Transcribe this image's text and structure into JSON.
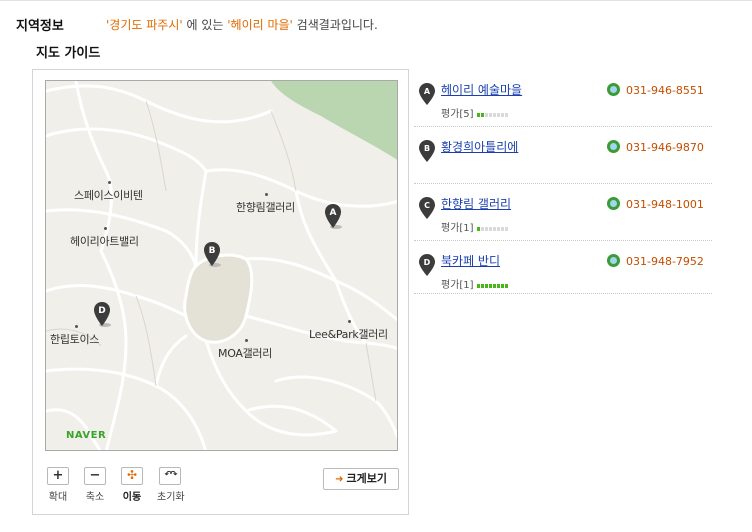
{
  "section": {
    "title": "지역정보"
  },
  "search_result": {
    "region": "'경기도 파주시'",
    "text1": " 에 있는 ",
    "keyword": "'헤이리 마을'",
    "text2": " 검색결과입니다."
  },
  "map": {
    "title": "지도 가이드",
    "places": [
      "스페이스이비텐",
      "한향림갤러리",
      "헤이리아트밸리",
      "한립토이스",
      "Lee&Park갤러리",
      "MOA갤러리"
    ],
    "markers": [
      "A",
      "B",
      "D"
    ],
    "logo": "NAVER",
    "controls": [
      {
        "symbol": "+",
        "label": "확대"
      },
      {
        "symbol": "−",
        "label": "축소"
      },
      {
        "symbol": "✣",
        "label": "이동"
      },
      {
        "symbol": "↶↷",
        "label": "초기화"
      }
    ],
    "bigview": {
      "arrow": "➜",
      "label": "크게보기"
    },
    "colors": {
      "land": "#f1efe9",
      "green": "#b9d6b0",
      "road": "#ffffff",
      "park": "#e4e1d6",
      "marker": "#3c3c3c"
    }
  },
  "results": [
    {
      "letter": "A",
      "name": "헤이리 예술마을",
      "rating_label": "평가[5]",
      "rating_filled": 2,
      "rating_total": 8,
      "phone": "031-946-8551"
    },
    {
      "letter": "B",
      "name": "황경희아틀리에",
      "rating_label": "",
      "rating_filled": 0,
      "rating_total": 0,
      "phone": "031-946-9870"
    },
    {
      "letter": "C",
      "name": "한향림 갤러리",
      "rating_label": "평가[1]",
      "rating_filled": 1,
      "rating_total": 8,
      "phone": "031-948-1001"
    },
    {
      "letter": "D",
      "name": "북카페 반디",
      "rating_label": "평가[1]",
      "rating_filled": 8,
      "rating_total": 8,
      "phone": "031-948-7952"
    }
  ]
}
